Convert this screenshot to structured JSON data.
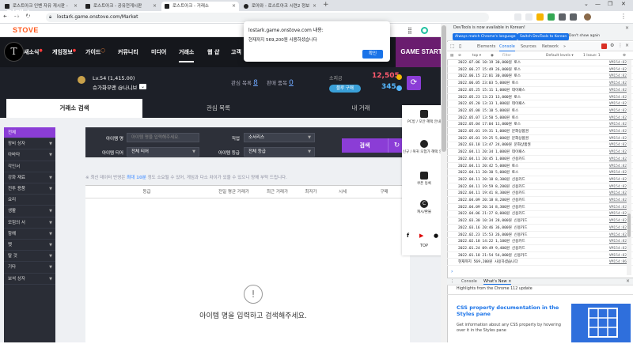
{
  "browser": {
    "tabs": [
      {
        "label": "로스트아크 인벤 자유 게시판 -"
      },
      {
        "label": "로스트아크 - 공유전게시판"
      },
      {
        "label": "로스트아크 - 거래소"
      },
      {
        "label": "로아와 - 로스트아크 시련2 정보"
      }
    ],
    "new_tab": "+",
    "url": "lostark.game.onstove.com/Market"
  },
  "site": {
    "stove_logo": "STOVE",
    "gnb": {
      "items": [
        {
          "label": "새소식"
        },
        {
          "label": "게임정보"
        },
        {
          "label": "가이드"
        },
        {
          "label": "커뮤니티"
        },
        {
          "label": "미디어"
        },
        {
          "label": "거래소"
        },
        {
          "label": "웹 샵"
        },
        {
          "label": "고객"
        }
      ],
      "game_start": "GAME START"
    },
    "market": {
      "title": "거래소",
      "character": {
        "level": "Lv.54 (1,415.00)",
        "name": "슈가화무맨 @나니브"
      },
      "watch_label": "관심 목록",
      "watch_count": "8",
      "sales_label": "판매 품목",
      "sales_count": "0",
      "currency_label": "소지금",
      "gold": "12,505",
      "crystal": "345",
      "charge_label": "블루 구매",
      "colors": {
        "accent": "#8b3dd6",
        "gold": "#ff5a6e",
        "crystal": "#55b7ff"
      }
    },
    "tabs": [
      {
        "label": "거래소 검색"
      },
      {
        "label": "관심 목록"
      },
      {
        "label": "내 거래"
      }
    ],
    "categories": [
      {
        "label": "전체"
      },
      {
        "label": "장비 상자"
      },
      {
        "label": "아바타"
      },
      {
        "label": "각인서"
      },
      {
        "label": "강화 재료"
      },
      {
        "label": "전투 용품"
      },
      {
        "label": "요리"
      },
      {
        "label": "생활"
      },
      {
        "label": "모험의 서"
      },
      {
        "label": "항해"
      },
      {
        "label": "펫"
      },
      {
        "label": "탈 것"
      },
      {
        "label": "기타"
      },
      {
        "label": "보석 상자"
      }
    ],
    "search": {
      "item_name_label": "아이템 명",
      "item_name_placeholder": "아이템 명을 입력해주세요.",
      "class_label": "직업",
      "class_value": "소서리스",
      "tier_label": "아이템 티어",
      "tier_value": "전체 티어",
      "grade_label": "아이템 등급",
      "grade_value": "전체 등급",
      "search_button": "검색",
      "reset_icon": "↻"
    },
    "notice_prefix": "※ 최신 데이터 반영은 ",
    "notice_highlight": "최대 10분",
    "notice_suffix": " 정도 소요될 수 있어, 게임과 다소 차이가 있을 수 있으니 양해 부탁 드립니다.",
    "table_headers": [
      {
        "label": "등급"
      },
      {
        "label": "전일 평균 거래가"
      },
      {
        "label": "최근 거래가"
      },
      {
        "label": "최저가"
      },
      {
        "label": "시세"
      },
      {
        "label": "구매"
      }
    ],
    "empty_icon": "!",
    "empty_message": "아이템 명을 입력하고 검색해주세요.",
    "quick_menu": [
      {
        "label": "PC방 / 모안 혜택 안내",
        "icon": "monitor-icon"
      },
      {
        "label": "신규 / 복귀 모험가 혜택 안내",
        "icon": "user-icon"
      },
      {
        "label": "쿠폰 등록",
        "icon": "coupon-icon"
      },
      {
        "label": "캐시/환불",
        "icon": "cash-icon"
      }
    ],
    "social": {
      "facebook": "f",
      "youtube": "▶",
      "chat": "●"
    },
    "top_label": "TOP"
  },
  "alert": {
    "title": "lostark.game.onstove.com 내용:",
    "message": "현재까지 569,200원 사용하셨습니다",
    "ok": "확인"
  },
  "devtools": {
    "banner": "DevTools is now available in Korean!",
    "match_btn": "Always match Chrome's language",
    "switch_btn": "Switch DevTools to Korean",
    "dont_show": "Don't show again",
    "tabs": [
      {
        "label": "Elements"
      },
      {
        "label": "Console"
      },
      {
        "label": "Sources"
      },
      {
        "label": "Network"
      },
      {
        "label": "»"
      }
    ],
    "filter": {
      "context": "top",
      "placeholder": "Filter",
      "levels": "Default levels",
      "issues": "1 Issue: 1"
    },
    "console_lines": [
      {
        "msg": "2022.07.06 10:19 30,000원 토스",
        "src": "VM154:82"
      },
      {
        "msg": "2022.06.27 15:49 26,000원 토스",
        "src": "VM154:82"
      },
      {
        "msg": "2022.06.15 22:01 30,000원 토스",
        "src": "VM154:82"
      },
      {
        "msg": "2022.06.05 23:03 5,000원 토스",
        "src": "VM154:82"
      },
      {
        "msg": "2022.05.25 15:11 1,000원 데이패스",
        "src": "VM154:82"
      },
      {
        "msg": "2022.05.23 13:23 13,000원 토스",
        "src": "VM154:82"
      },
      {
        "msg": "2022.05.20 13:33 1,000원 데이패스",
        "src": "VM154:82"
      },
      {
        "msg": "2022.05.08 15:10 5,000원 토스",
        "src": "VM154:82"
      },
      {
        "msg": "2022.05.07 13:50 5,000원 토스",
        "src": "VM154:82"
      },
      {
        "msg": "2022.05.04 17:04 11,000원 토스",
        "src": "VM154:82"
      },
      {
        "msg": "2022.05.01 19:31 1,000원 문화상품권",
        "src": "VM154:82"
      },
      {
        "msg": "2022.05.01 19:25 5,000원 문화상품권",
        "src": "VM154:82"
      },
      {
        "msg": "2022.03.18 13:47 24,000원 문화상품권",
        "src": "VM154:82"
      },
      {
        "msg": "2022.04.11 20:34 1,000원 데이패스",
        "src": "VM154:82"
      },
      {
        "msg": "2022.04.11 20:45 1,000원 신용카드",
        "src": "VM154:82"
      },
      {
        "msg": "2022.04.11 20:42 5,000원 토스",
        "src": "VM154:82"
      },
      {
        "msg": "2022.04.11 20:30 5,000원 토스",
        "src": "VM154:82"
      },
      {
        "msg": "2022.04.11 20:18 8,300원 신용카드",
        "src": "VM154:82"
      },
      {
        "msg": "2022.04.11 19:59 8,200원 신용카드",
        "src": "VM154:82"
      },
      {
        "msg": "2022.04.11 19:41 8,300원 신용카드",
        "src": "VM154:82"
      },
      {
        "msg": "2022.04.09 20:18 8,200원 신용카드",
        "src": "VM154:82"
      },
      {
        "msg": "2022.04.09 20:14 8,300원 신용카드",
        "src": "VM154:82"
      },
      {
        "msg": "2022.04.06 21:27 8,000원 신용카드",
        "src": "VM154:82"
      },
      {
        "msg": "2022.03.30 10:34 28,000원 신용카드",
        "src": "VM154:82"
      },
      {
        "msg": "2022.03.16 20:46 36,000원 신용카드",
        "src": "VM154:82"
      },
      {
        "msg": "2022.02.23 15:53 26,000원 신용카드",
        "src": "VM154:82"
      },
      {
        "msg": "2022.02.18 14:22 1,100원 신용카드",
        "src": "VM154:82"
      },
      {
        "msg": "2022.01.24 09:49 9,400원 신용카드",
        "src": "VM154:82"
      },
      {
        "msg": "2022.01.18 21:54 54,000원 신용카드",
        "src": "VM154:82"
      },
      {
        "msg": "현재까지 569,200원 사용하셨습니다",
        "src": "VM154:86"
      }
    ],
    "drawer_tabs": [
      {
        "label": "Console"
      },
      {
        "label": "What's New ×"
      }
    ],
    "drawer_msg": "Highlights from the Chrome 112 update",
    "promo_title": "CSS property documentation in the Styles pane",
    "promo_body": "Get information about any CSS property by hovering over it in the Styles pane"
  }
}
